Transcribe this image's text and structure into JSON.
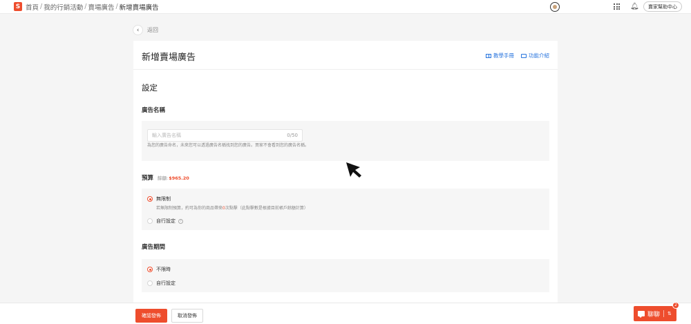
{
  "breadcrumb": {
    "items": [
      "首頁",
      "我的行銷活動",
      "賣場廣告"
    ],
    "current": "新增賣場廣告"
  },
  "topbar": {
    "help_label": "賣家幫助中心"
  },
  "back": {
    "label": "返回"
  },
  "card": {
    "title": "新增賣場廣告",
    "links": {
      "tutorial": "教學手冊",
      "intro": "功能介紹"
    }
  },
  "settings": {
    "section_title": "設定",
    "ad_name": {
      "label": "廣告名稱",
      "placeholder": "輸入廣告名稱",
      "value": "",
      "counter": "0/50",
      "hint": "為您的廣告命名，未來您可以透過廣告名稱找到您的廣告。買家不會看到您的廣告名稱。"
    },
    "budget": {
      "label": "預算",
      "balance_label": "餘額:",
      "balance_value": "$965.20",
      "options": [
        {
          "label": "無限制",
          "selected": true
        },
        {
          "label": "自行設定",
          "selected": false
        }
      ],
      "unlimited_desc_before": "若無限制預算，約可為你的商品帶來",
      "unlimited_desc_num": "0",
      "unlimited_desc_after": "次點擊（此點擊數是根據目前帳戶餘額計算）"
    },
    "period": {
      "label": "廣告期間",
      "options": [
        {
          "label": "不限時",
          "selected": true
        },
        {
          "label": "自行設定",
          "selected": false
        }
      ]
    }
  },
  "actions": {
    "confirm": "確認發佈",
    "cancel": "取消發佈"
  },
  "chat": {
    "label": "聊聊",
    "badge": "2"
  },
  "colors": {
    "accent": "#ee4d2d",
    "link": "#2673dd"
  },
  "icons": [
    "shopee-logo",
    "avatar",
    "apps-grid-icon",
    "bell-icon",
    "back-arrow-icon",
    "book-icon",
    "video-icon",
    "question-icon",
    "chat-icon",
    "mouse-cursor"
  ]
}
